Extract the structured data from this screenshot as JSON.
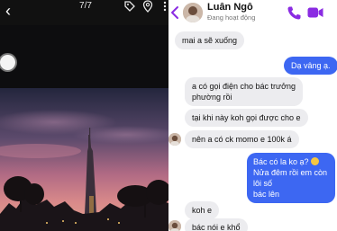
{
  "viewer": {
    "counter": "7/7",
    "icons": {
      "back": "back-arrow-icon",
      "tag": "tag-icon",
      "location": "location-pin-icon",
      "more": "more-icon"
    }
  },
  "chat": {
    "contact_name": "Luân Ngô",
    "status": "Đang hoạt động",
    "icons": {
      "back": "back-chevron-icon",
      "call": "phone-icon",
      "video": "video-camera-icon"
    },
    "messages": [
      {
        "from": "them",
        "text": "mai a sẽ xuống"
      },
      {
        "from": "me",
        "text": "Dạ vâng ạ."
      },
      {
        "from": "them",
        "lines": [
          "a có gọi điện cho bác trưởng",
          "phường rồi"
        ]
      },
      {
        "from": "them",
        "text": "tại khi này koh gọi được cho e"
      },
      {
        "from": "them",
        "text": "nên a có ck momo e 100k á"
      },
      {
        "from": "me",
        "lines": [
          "Bác có la ko ạ?",
          "Nửa đêm rồi em còn lôi số",
          "bác lên"
        ]
      },
      {
        "from": "them",
        "text": "koh e"
      },
      {
        "from": "them",
        "text": "bác nói e khổ"
      }
    ],
    "colors": {
      "sent_bubble": "#3d67f2",
      "received_bubble": "#ececef",
      "accent": "#8a2be2"
    }
  }
}
